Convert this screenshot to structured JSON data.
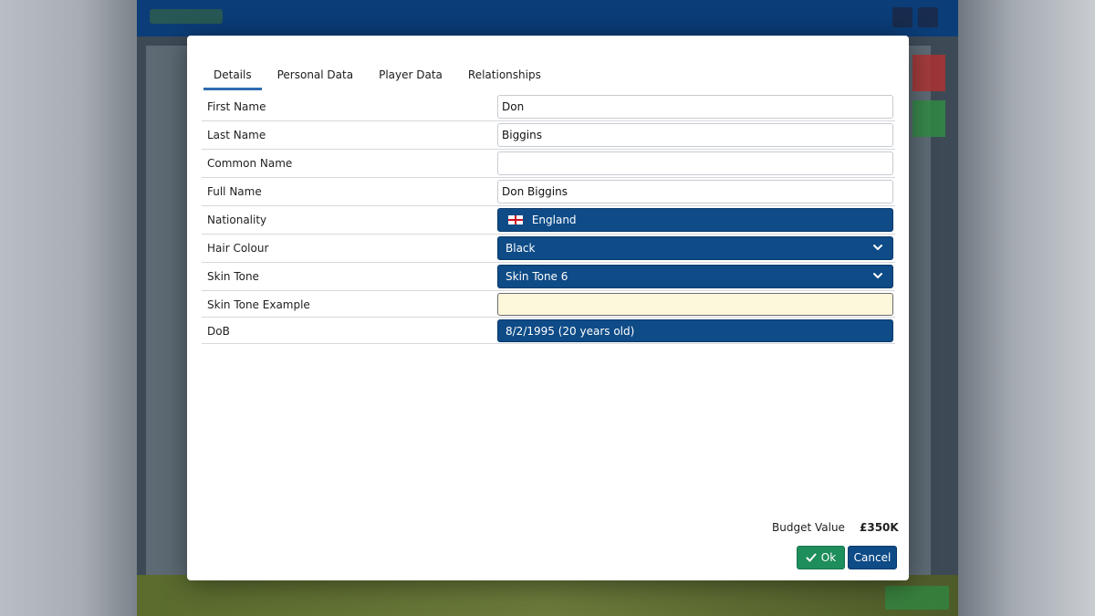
{
  "tabs": [
    {
      "label": "Details"
    },
    {
      "label": "Personal Data"
    },
    {
      "label": "Player Data"
    },
    {
      "label": "Relationships"
    }
  ],
  "active_tab": "Details",
  "fields": {
    "first_name": {
      "label": "First Name",
      "value": "Don"
    },
    "last_name": {
      "label": "Last Name",
      "value": "Biggins"
    },
    "common_name": {
      "label": "Common Name",
      "value": ""
    },
    "full_name": {
      "label": "Full Name",
      "value": "Don Biggins"
    },
    "nationality": {
      "label": "Nationality",
      "value": "England",
      "icon": "england-flag-icon"
    },
    "hair_colour": {
      "label": "Hair Colour",
      "value": "Black"
    },
    "skin_tone": {
      "label": "Skin Tone",
      "value": "Skin Tone 6"
    },
    "skin_tone_example": {
      "label": "Skin Tone Example",
      "value": ""
    },
    "dob": {
      "label": "DoB",
      "value": "8/2/1995 (20 years old)"
    }
  },
  "budget": {
    "label": "Budget Value",
    "value": "£350K"
  },
  "buttons": {
    "ok": "Ok",
    "cancel": "Cancel"
  },
  "colors": {
    "accent_blue": "#0e4b87",
    "ok_green": "#1e8e5c",
    "tab_underline": "#2e6db1",
    "example_fill": "#fdf7dc"
  }
}
